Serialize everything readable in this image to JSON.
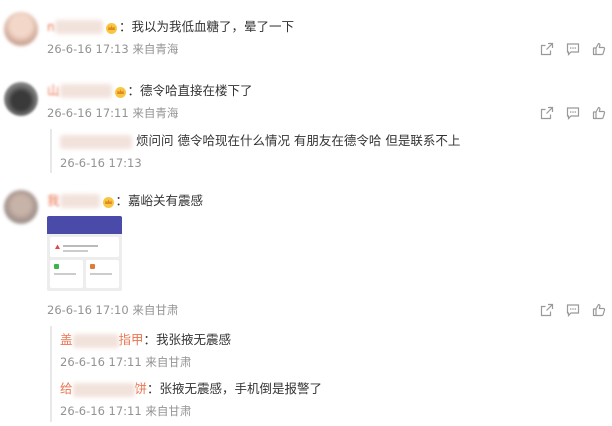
{
  "comments": [
    {
      "name": "n",
      "text": "：我以为我低血糖了，晕了一下",
      "time": "26-6-16 17:13",
      "source": "来自青海"
    },
    {
      "name": "山",
      "text": "：德令哈直接在楼下了",
      "time": "26-6-16 17:11",
      "source": "来自青海",
      "replies": [
        {
          "name": "",
          "text": "烦问问 德令哈现在什么情况 有朋友在德令哈 但是联系不上",
          "time": "26-6-16 17:13"
        }
      ]
    },
    {
      "name": "我",
      "text": "：嘉峪关有震感",
      "time": "26-6-16 17:10",
      "source": "来自甘肃",
      "replies": [
        {
          "name": "盖",
          "name_suffix": "指甲",
          "text": "：我张掖无震感",
          "time": "26-6-16 17:11",
          "source": "来自甘肃"
        },
        {
          "name": "给",
          "name_suffix": "饼",
          "text": "：张掖无震感，手机倒是报警了",
          "time": "26-6-16 17:11",
          "source": "来自甘肃"
        }
      ]
    }
  ],
  "colors": {
    "accent": "#eb7350",
    "meta": "#939393",
    "text": "#333333"
  },
  "icons": [
    "share-icon",
    "comment-icon",
    "like-icon",
    "crown-icon"
  ]
}
